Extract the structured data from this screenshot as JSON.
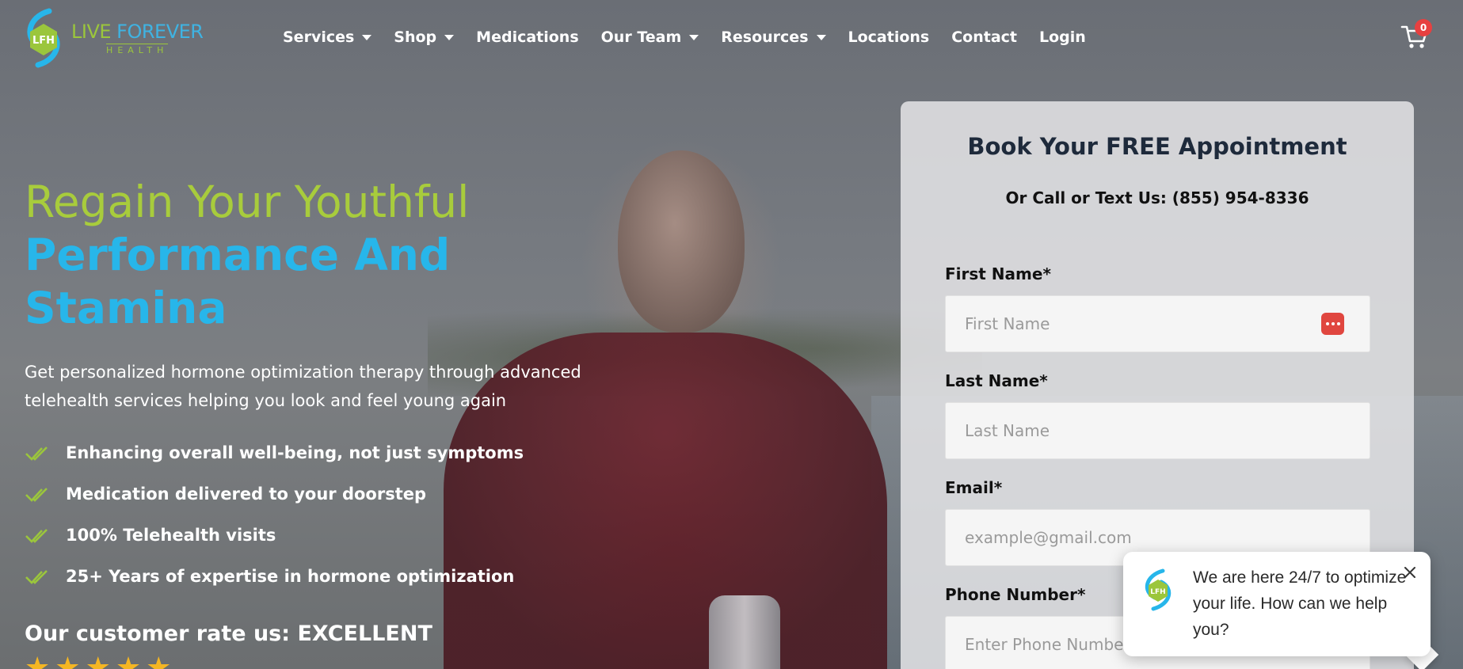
{
  "brand": {
    "name_line1_a": "LIVE ",
    "name_line1_b": "FOREVER",
    "name_line2": "HEALTH",
    "mark_initials": "LFH",
    "colors": {
      "blue": "#27b6ea",
      "green": "#a8cc3c"
    }
  },
  "nav": {
    "items": [
      {
        "label": "Services",
        "has_dropdown": true
      },
      {
        "label": "Shop",
        "has_dropdown": true
      },
      {
        "label": "Medications",
        "has_dropdown": false
      },
      {
        "label": "Our Team",
        "has_dropdown": true
      },
      {
        "label": "Resources",
        "has_dropdown": true
      },
      {
        "label": "Locations",
        "has_dropdown": false
      },
      {
        "label": "Contact",
        "has_dropdown": false
      },
      {
        "label": "Login",
        "has_dropdown": false
      }
    ],
    "cart_icon": "cart-icon",
    "cart_count": "0"
  },
  "hero": {
    "headline_line1": "Regain Your Youthful",
    "headline_line2": "Performance And",
    "headline_line3": "Stamina",
    "subtitle": "Get personalized hormone optimization therapy through advanced telehealth services helping you look and feel young again",
    "features": [
      "Enhancing overall well-being, not just symptoms",
      "Medication delivered to your doorstep",
      "100% Telehealth visits",
      "25+ Years of expertise in hormone optimization"
    ],
    "rating_text": "Our customer rate us: EXCELLENT",
    "stars": 5
  },
  "form": {
    "title": "Book Your FREE Appointment",
    "call_text": "Or Call or Text Us: (855) 954-8336",
    "fields": [
      {
        "label": "First Name*",
        "placeholder": "First Name"
      },
      {
        "label": "Last Name*",
        "placeholder": "Last Name"
      },
      {
        "label": "Email*",
        "placeholder": "example@gmail.com"
      },
      {
        "label": "Phone Number*",
        "placeholder": "Enter Phone Number"
      }
    ]
  },
  "chat": {
    "message": "We are here 24/7 to optimize your life. How can we help you?"
  }
}
